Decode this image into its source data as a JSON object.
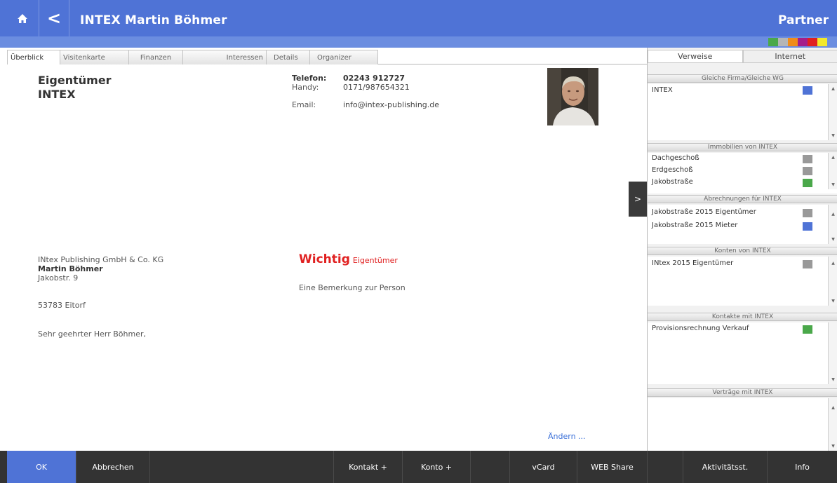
{
  "header": {
    "home_icon": "home-icon",
    "back_icon": "back-arrow-icon",
    "back_label": "<",
    "title": "INTEX Martin Böhmer",
    "right_label": "Partner",
    "swatches": [
      "#4aa84a",
      "#b5b5b5",
      "#f08c1a",
      "#a51e8a",
      "#e02020",
      "#f2e82a"
    ]
  },
  "tabs": [
    "Überblick",
    "Visitenkarte",
    "Finanzen",
    "Interessen",
    "Details",
    "Organizer"
  ],
  "overview": {
    "role": "Eigentümer",
    "company": "INTEX",
    "contact": {
      "phone_label": "Telefon:",
      "phone": "02243 912727",
      "mobile_label": "Handy:",
      "mobile": "0171/987654321",
      "email_label": "Email:",
      "email": "info@intex-publishing.de"
    },
    "arrow": ">",
    "address": {
      "company": "INtex Publishing GmbH & Co. KG",
      "name": "Martin Böhmer",
      "street": "Jakobstr. 9",
      "city": "53783 Eitorf"
    },
    "salutation": "Sehr geehrter Herr Böhmer,",
    "important": "Wichtig",
    "important_tag": "Eigentümer",
    "remark": "Eine Bemerkung zur Person",
    "edit_link": "Ändern ..."
  },
  "right_panel": {
    "tabs": [
      "Verweise",
      "Internet"
    ],
    "sections": [
      {
        "title": "Gleiche Firma/Gleiche WG",
        "items": [
          {
            "label": "INTEX",
            "color": "#4f73d6"
          }
        ]
      },
      {
        "title": "Immobilien von INTEX",
        "items": [
          {
            "label": "Dachgeschoß",
            "color": "#999999"
          },
          {
            "label": "Erdgeschoß",
            "color": "#999999"
          },
          {
            "label": "Jakobstraße",
            "color": "#4aa84a"
          }
        ]
      },
      {
        "title": "Abrechnungen für INTEX",
        "items": [
          {
            "label": "Jakobstraße 2015 Eigentümer",
            "color": "#999999"
          },
          {
            "label": "Jakobstraße 2015 Mieter",
            "color": "#4f73d6"
          }
        ]
      },
      {
        "title": "Konten von INTEX",
        "items": [
          {
            "label": "INtex  2015 Eigentümer",
            "color": "#999999"
          }
        ]
      },
      {
        "title": "Kontakte mit INTEX",
        "items": [
          {
            "label": "Provisionsrechnung Verkauf",
            "color": "#4aa84a"
          }
        ]
      },
      {
        "title": "Verträge mit INTEX",
        "items": []
      }
    ]
  },
  "footer": {
    "ok": "OK",
    "cancel": "Abbrechen",
    "contact_add": "Kontakt +",
    "account_add": "Konto +",
    "vcard": "vCard",
    "web_share": "WEB Share",
    "activity": "Aktivitätsst.",
    "info": "Info"
  }
}
